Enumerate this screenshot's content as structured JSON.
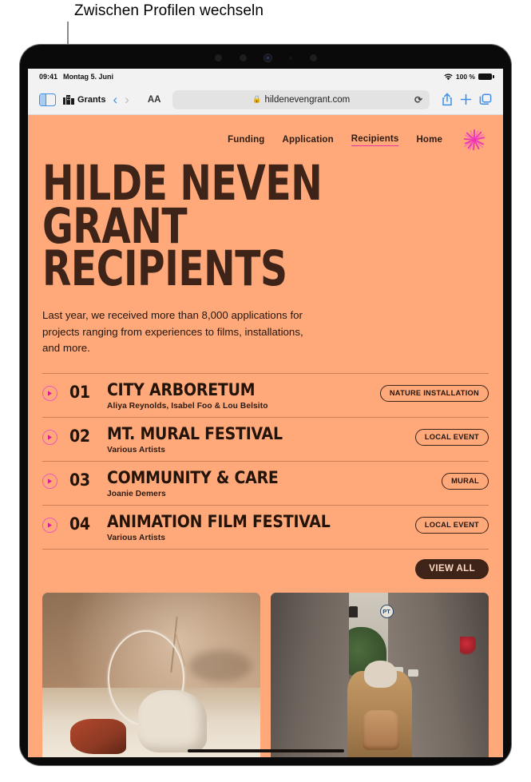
{
  "callout": {
    "text": "Zwischen Profilen wechseln"
  },
  "status_bar": {
    "time": "09:41",
    "date": "Montag 5. Juni",
    "wifi_icon": "wifi-icon",
    "battery_percent": "100 %",
    "battery_icon": "battery-icon"
  },
  "toolbar": {
    "sidebar_icon": "sidebar-icon",
    "profile_icon": "grants-profile-icon",
    "profile_label": "Grants",
    "back_icon": "chevron-left-icon",
    "forward_icon": "chevron-right-icon",
    "text_size_label": "AA",
    "lock_icon": "lock-icon",
    "url": "hildenevengrant.com",
    "reload_icon": "reload-icon",
    "share_icon": "share-icon",
    "new_tab_icon": "plus-icon",
    "tabs_icon": "tabs-icon"
  },
  "site": {
    "nav": [
      {
        "label": "Funding",
        "active": false
      },
      {
        "label": "Application",
        "active": false
      },
      {
        "label": "Recipients",
        "active": true
      },
      {
        "label": "Home",
        "active": false
      }
    ],
    "logo_icon": "flower-burst-logo",
    "headline_line1": "HILDE NEVEN",
    "headline_line2": "GRANT RECIPIENTS",
    "intro": "Last year, we received more than 8,000 applications for projects ranging from experiences to films, installations, and more.",
    "recipients": [
      {
        "number": "01",
        "title": "CITY ARBORETUM",
        "artists": "Aliya Reynolds, Isabel Foo & Lou Belsito",
        "tag": "NATURE INSTALLATION",
        "arrow_icon": "play-arrow-icon"
      },
      {
        "number": "02",
        "title": "MT. MURAL FESTIVAL",
        "artists": "Various Artists",
        "tag": "LOCAL EVENT",
        "arrow_icon": "play-arrow-icon"
      },
      {
        "number": "03",
        "title": "COMMUNITY & CARE",
        "artists": "Joanie Demers",
        "tag": "MURAL",
        "arrow_icon": "play-arrow-icon"
      },
      {
        "number": "04",
        "title": "ANIMATION FILM FESTIVAL",
        "artists": "Various Artists",
        "tag": "LOCAL EVENT",
        "arrow_icon": "play-arrow-icon"
      }
    ],
    "view_all_label": "VIEW ALL",
    "photos": [
      {
        "name": "still-life-sculpture-photo",
        "alt_sign": ""
      },
      {
        "name": "street-alley-walker-photo",
        "alt_sign": "PT"
      }
    ]
  },
  "colors": {
    "page_background": "#FFA97A",
    "brand_dark": "#3D2318",
    "accent_pink": "#E834A8",
    "toolbar_blue": "#3E8FE8"
  }
}
